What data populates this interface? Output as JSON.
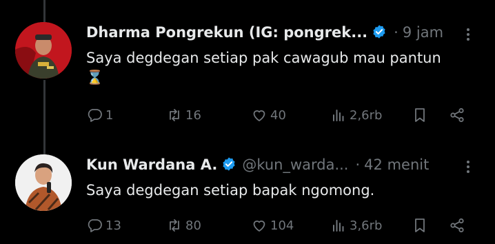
{
  "tweets": [
    {
      "name": "Dharma Pongrekun (IG: pongrek...",
      "time": "9 jam",
      "text": "Saya degdegan setiap pak cawagub mau pantun",
      "emoji": "⌛",
      "counts": {
        "replies": "1",
        "retweets": "16",
        "likes": "40",
        "views": "2,6rb"
      }
    },
    {
      "name": "Kun Wardana A.",
      "handle": "@kun_warda...",
      "time": "42 menit",
      "text": "Saya degdegan setiap bapak ngomong.",
      "counts": {
        "replies": "13",
        "retweets": "80",
        "likes": "104",
        "views": "3,6rb"
      }
    }
  ],
  "separator": "·",
  "colors": {
    "verified": "#1d9bf0",
    "muted": "#71767b",
    "text": "#e7e9ea",
    "thread_line": "#333639"
  }
}
